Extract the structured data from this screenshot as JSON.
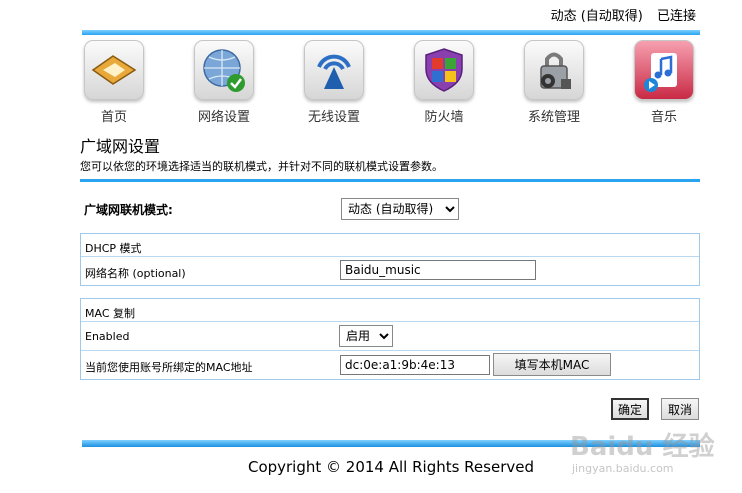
{
  "status": {
    "mode": "动态 (自动取得)",
    "connection": "已连接"
  },
  "nav": [
    {
      "label": "首页",
      "icon": "home-icon"
    },
    {
      "label": "网络设置",
      "icon": "globe-check-icon"
    },
    {
      "label": "无线设置",
      "icon": "wireless-icon"
    },
    {
      "label": "防火墙",
      "icon": "shield-icon"
    },
    {
      "label": "系统管理",
      "icon": "lock-gear-icon"
    },
    {
      "label": "音乐",
      "icon": "music-icon"
    }
  ],
  "page": {
    "title": "广域网设置",
    "description": "您可以依您的环境选择适当的联机模式，并针对不同的联机模式设置参数。"
  },
  "wan": {
    "mode_label": "广域网联机模式:",
    "mode_value": "动态 (自动取得)"
  },
  "dhcp": {
    "header": "DHCP 模式",
    "hostname_label": "网络名称 (optional)",
    "hostname_value": "Baidu_music"
  },
  "mac": {
    "header": "MAC 复制",
    "enabled_label": "Enabled",
    "enabled_value": "启用",
    "address_label": "当前您使用账号所绑定的MAC地址",
    "address_value": "dc:0e:a1:9b:4e:13",
    "fill_button": "填写本机MAC"
  },
  "actions": {
    "ok": "确定",
    "cancel": "取消"
  },
  "footer": {
    "copyright": "Copyright © 2014 All Rights Reserved"
  },
  "watermark": {
    "brand": "Baidu 经验",
    "url": "jingyan.baidu.com"
  },
  "colors": {
    "accent_blue": "#2aa3f0",
    "box_border": "#9ec9ea"
  }
}
